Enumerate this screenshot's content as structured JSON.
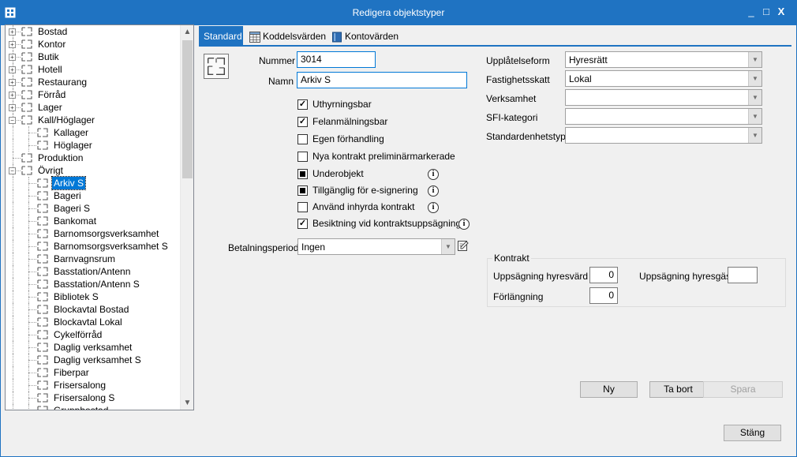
{
  "window": {
    "title": "Redigera objektstyper",
    "controls": {
      "minimize": "_",
      "maximize": "□",
      "close": "X"
    }
  },
  "tree": {
    "items": [
      {
        "label": "Bostad",
        "level": 0,
        "expander": "+"
      },
      {
        "label": "Kontor",
        "level": 0,
        "expander": "+"
      },
      {
        "label": "Butik",
        "level": 0,
        "expander": "+"
      },
      {
        "label": "Hotell",
        "level": 0,
        "expander": "+"
      },
      {
        "label": "Restaurang",
        "level": 0,
        "expander": "+"
      },
      {
        "label": "Förråd",
        "level": 0,
        "expander": "+"
      },
      {
        "label": "Lager",
        "level": 0,
        "expander": "+"
      },
      {
        "label": "Kall/Höglager",
        "level": 0,
        "expander": "−"
      },
      {
        "label": "Kallager",
        "level": 1
      },
      {
        "label": "Höglager",
        "level": 1
      },
      {
        "label": "Produktion",
        "level": 0
      },
      {
        "label": "Övrigt",
        "level": 0,
        "expander": "−"
      },
      {
        "label": "Arkiv S",
        "level": 1,
        "selected": true
      },
      {
        "label": "Bageri",
        "level": 1
      },
      {
        "label": "Bageri S",
        "level": 1
      },
      {
        "label": "Bankomat",
        "level": 1
      },
      {
        "label": "Barnomsorgsverksamhet",
        "level": 1
      },
      {
        "label": "Barnomsorgsverksamhet S",
        "level": 1
      },
      {
        "label": "Barnvagnsrum",
        "level": 1
      },
      {
        "label": "Basstation/Antenn",
        "level": 1
      },
      {
        "label": "Basstation/Antenn S",
        "level": 1
      },
      {
        "label": "Bibliotek S",
        "level": 1
      },
      {
        "label": "Blockavtal Bostad",
        "level": 1
      },
      {
        "label": "Blockavtal Lokal",
        "level": 1
      },
      {
        "label": "Cykelförråd",
        "level": 1
      },
      {
        "label": "Daglig verksamhet",
        "level": 1
      },
      {
        "label": "Daglig verksamhet S",
        "level": 1
      },
      {
        "label": "Fiberpar",
        "level": 1
      },
      {
        "label": "Frisersalong",
        "level": 1
      },
      {
        "label": "Frisersalong S",
        "level": 1
      },
      {
        "label": "Gruppbostad",
        "level": 1
      }
    ],
    "scroll_up": "▲",
    "scroll_down": "▼"
  },
  "tabs": [
    {
      "label": "Standard",
      "active": true
    },
    {
      "label": "Koddelsvärden",
      "active": false
    },
    {
      "label": "Kontovärden",
      "active": false
    }
  ],
  "form": {
    "nummer_label": "Nummer",
    "nummer_value": "3014",
    "namn_label": "Namn",
    "namn_value": "Arkiv S",
    "checkboxes": [
      {
        "label": "Uthyrningsbar",
        "state": "checked",
        "info": false
      },
      {
        "label": "Felanmälningsbar",
        "state": "checked",
        "info": false
      },
      {
        "label": "Egen förhandling",
        "state": "unchecked",
        "info": false
      },
      {
        "label": "Nya kontrakt preliminärmarkerade",
        "state": "unchecked",
        "info": false
      },
      {
        "label": "Underobjekt",
        "state": "indeterminate",
        "info": true
      },
      {
        "label": "Tillgänglig för e-signering",
        "state": "indeterminate",
        "info": true
      },
      {
        "label": "Använd inhyrda kontrakt",
        "state": "unchecked",
        "info": true
      },
      {
        "label": "Besiktning vid kontraktsuppsägning",
        "state": "checked",
        "info": true
      }
    ],
    "check_mark": "✓",
    "info_glyph": "i",
    "betalningsperiod_label": "Betalningsperiod",
    "betalningsperiod_value": "Ingen"
  },
  "right_fields": [
    {
      "label": "Upplåtelseform",
      "value": "Hyresrätt"
    },
    {
      "label": "Fastighetsskatt",
      "value": "Lokal"
    },
    {
      "label": "Verksamhet",
      "value": ""
    },
    {
      "label": "SFI-kategori",
      "value": ""
    },
    {
      "label": "Standardenhetstyp",
      "value": ""
    }
  ],
  "kontrakt": {
    "title": "Kontrakt",
    "uppsagning_hyresvard_label": "Uppsägning hyresvärd",
    "uppsagning_hyresvard_value": "0",
    "uppsagning_hyresgast_label": "Uppsägning hyresgäst",
    "uppsagning_hyresgast_value": "",
    "forlangning_label": "Förlängning",
    "forlangning_value": "0"
  },
  "buttons": {
    "ny": "Ny",
    "ta_bort": "Ta bort",
    "spara": "Spara",
    "stang": "Stäng"
  },
  "colors": {
    "accent": "#1f73c2",
    "selection": "#0078d7"
  }
}
